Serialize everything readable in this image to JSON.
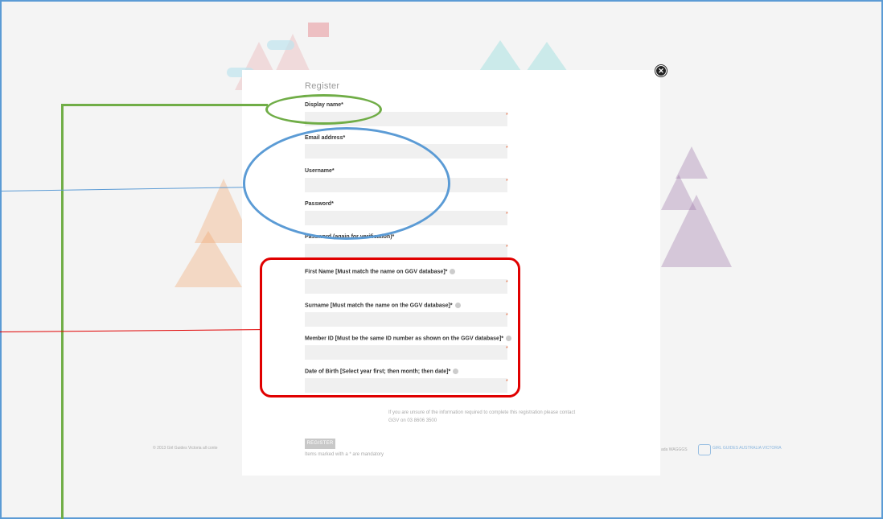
{
  "form": {
    "title": "Register",
    "fields": [
      {
        "label": "Display name*"
      },
      {
        "label": "Email address*"
      },
      {
        "label": "Username*"
      },
      {
        "label": "Password*"
      },
      {
        "label": "Password (again for verification)*"
      },
      {
        "label": "First Name [Must match the name on GGV database]*"
      },
      {
        "label": "Surname [Must match the name on the GGV database]*"
      },
      {
        "label": "Member ID [Must be the same ID number as shown on the GGV database]*"
      },
      {
        "label": "Date of Birth [Select year first; then month; then date]*"
      }
    ],
    "required_marker": "*",
    "help_line1": "If you are unsure of the information required to complete this registration please contact",
    "help_line2": "GGV on 03 8606 3500",
    "register_label": "REGISTER",
    "mandatory_note": "Items marked with a * are mandatory"
  },
  "footer": {
    "copyright": "© 2013 Girl Guides Victoria all conte",
    "links": "ada  WAGGGS",
    "logo_text": "GIRL GUIDES AUSTRALIA VICTORIA"
  },
  "close_icon": "close-icon",
  "annotations": {
    "green": "#70ad47",
    "blue": "#5b9bd5",
    "red": "#e00000"
  }
}
